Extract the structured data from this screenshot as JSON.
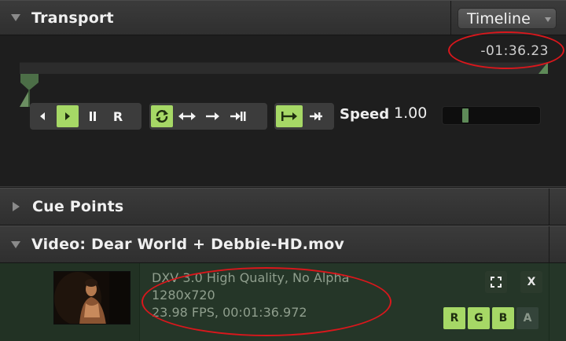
{
  "transport": {
    "title": "Transport",
    "mode_select": "Timeline",
    "time_remaining": "-01:36.23",
    "buttons": {
      "prev_frame": "prev",
      "play": "play",
      "pause": "pause",
      "reverse": "R",
      "loop": "loop",
      "bounce": "bounce",
      "play_once": "play-once",
      "play_once_hold": "play-once-hold",
      "cue_jump": "cue-in",
      "cue_out": "cue-out"
    },
    "speed_label": "Speed",
    "speed_value": "1.00",
    "speed_level": 0.22
  },
  "cue_points": {
    "title": "Cue Points"
  },
  "video": {
    "title": "Video: Dear World + Debbie-HD.mov",
    "codec": "DXV 3.0 High Quality, No Alpha",
    "resolution": "1280x720",
    "fps_duration": "23.98 FPS, 00:01:36.972",
    "channels": [
      "R",
      "G",
      "B",
      "A"
    ],
    "channel_states": [
      true,
      true,
      true,
      false
    ],
    "close_label": "X"
  },
  "colors": {
    "accent_green": "#a6d866",
    "annotation_red": "#d9171c",
    "video_panel_bg": "#253628",
    "playhead_green": "#5e8a58"
  }
}
